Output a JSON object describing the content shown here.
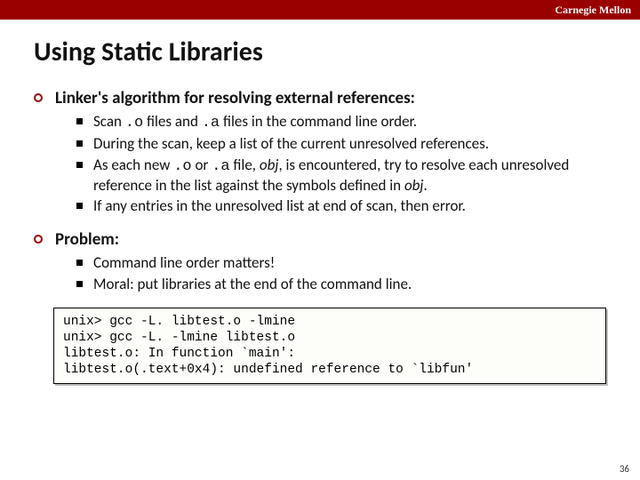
{
  "brand": "Carnegie Mellon",
  "title": "Using Static Libraries",
  "section1": {
    "heading": "Linker's algorithm for resolving external references:",
    "b1a": "Scan ",
    "b1b": ".o",
    "b1c": " files and ",
    "b1d": ".a",
    "b1e": " files in the command line order.",
    "b2": "During the scan, keep a list of the current unresolved references.",
    "b3a": "As each new ",
    "b3b": ".o",
    "b3c": " or ",
    "b3d": ".a",
    "b3e": " file, ",
    "b3f": "obj",
    "b3g": ", is encountered, try to resolve each unresolved reference in the list against the symbols defined in ",
    "b3h": "obj",
    "b3i": ".",
    "b4": "If any entries in the unresolved list at end of scan, then error."
  },
  "section2": {
    "heading": "Problem:",
    "b1": "Command line order matters!",
    "b2": "Moral: put libraries at the end of the command line."
  },
  "code": "unix> gcc -L. libtest.o -lmine\nunix> gcc -L. -lmine libtest.o\nlibtest.o: In function `main':\nlibtest.o(.text+0x4): undefined reference to `libfun'",
  "page": "36"
}
